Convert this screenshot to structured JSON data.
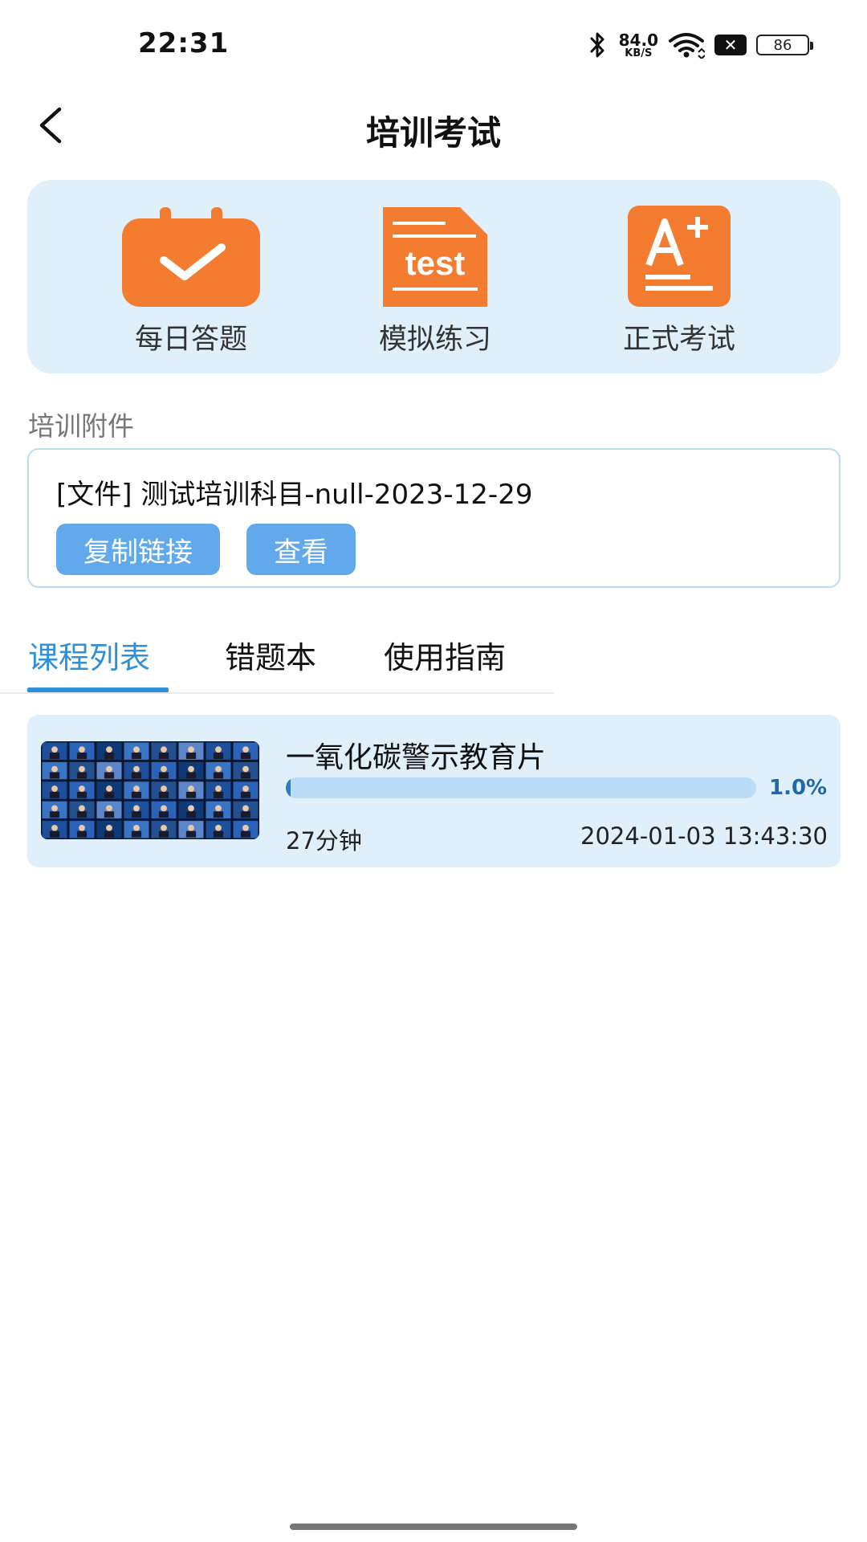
{
  "status_bar": {
    "time": "22:31",
    "net_speed_value": "84.0",
    "net_speed_unit": "KB/S",
    "battery": "86",
    "icons": [
      "bluetooth-icon",
      "wifi-icon",
      "x-icon",
      "battery-icon"
    ]
  },
  "header": {
    "title": "培训考试",
    "back_icon": "chevron-left-icon"
  },
  "actions": [
    {
      "label": "每日答题",
      "icon": "calendar-check-icon",
      "color": "#f47c30"
    },
    {
      "label": "模拟练习",
      "icon": "test-document-icon",
      "color": "#f47c30",
      "icon_text": "test"
    },
    {
      "label": "正式考试",
      "icon": "grade-a-plus-icon",
      "color": "#f47c30",
      "icon_text": "A+"
    }
  ],
  "attachments": {
    "section_label": "培训附件",
    "file_name": "[文件] 测试培训科目-null-2023-12-29",
    "copy_link_label": "复制链接",
    "view_label": "查看"
  },
  "tabs": [
    {
      "label": "课程列表",
      "active": true
    },
    {
      "label": "错题本",
      "active": false
    },
    {
      "label": "使用指南",
      "active": false
    }
  ],
  "courses": [
    {
      "title": "一氧化碳警示教育片",
      "progress_percent": 1.0,
      "progress_label": "1.0%",
      "duration": "27分钟",
      "date": "2024-01-03 13:43:30"
    }
  ],
  "colors": {
    "accent": "#2f8fd9",
    "panel_bg": "#dff0fb",
    "button_bg": "#62a9ec",
    "icon_orange": "#f47c30"
  }
}
